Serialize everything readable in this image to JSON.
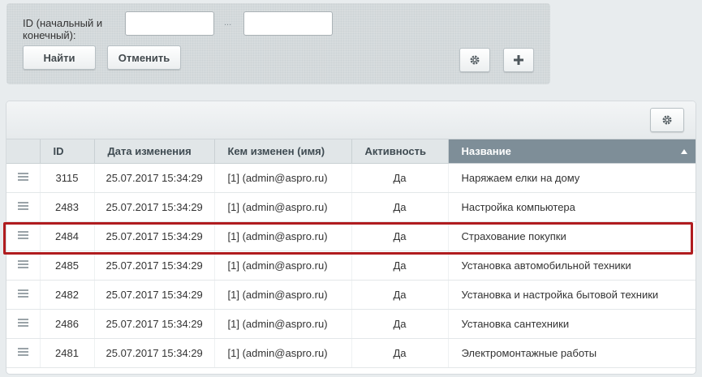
{
  "filter": {
    "id_label": "ID (начальный и конечный):",
    "id_from": "",
    "id_to": "",
    "range_separator": "...",
    "find_label": "Найти",
    "cancel_label": "Отменить",
    "settings_icon": "gear-icon",
    "add_icon": "plus-icon"
  },
  "list": {
    "settings_icon": "gear-icon",
    "columns": [
      "ID",
      "Дата изменения",
      "Кем изменен (имя)",
      "Активность",
      "Название"
    ],
    "sorted_column": "Название",
    "rows": [
      {
        "id": "3115",
        "date": "25.07.2017 15:34:29",
        "user": "[1] (admin@aspro.ru)",
        "active": "Да",
        "name": "Наряжаем елки на дому"
      },
      {
        "id": "2483",
        "date": "25.07.2017 15:34:29",
        "user": "[1] (admin@aspro.ru)",
        "active": "Да",
        "name": "Настройка компьютера"
      },
      {
        "id": "2484",
        "date": "25.07.2017 15:34:29",
        "user": "[1] (admin@aspro.ru)",
        "active": "Да",
        "name": "Страхование покупки"
      },
      {
        "id": "2485",
        "date": "25.07.2017 15:34:29",
        "user": "[1] (admin@aspro.ru)",
        "active": "Да",
        "name": "Установка автомобильной техники"
      },
      {
        "id": "2482",
        "date": "25.07.2017 15:34:29",
        "user": "[1] (admin@aspro.ru)",
        "active": "Да",
        "name": "Установка и настройка бытовой техники"
      },
      {
        "id": "2486",
        "date": "25.07.2017 15:34:29",
        "user": "[1] (admin@aspro.ru)",
        "active": "Да",
        "name": "Установка сантехники"
      },
      {
        "id": "2481",
        "date": "25.07.2017 15:34:29",
        "user": "[1] (admin@aspro.ru)",
        "active": "Да",
        "name": "Электромонтажные работы"
      }
    ]
  },
  "colors": {
    "highlight": "#b01c1f",
    "sorted_header": "#7e8e98"
  }
}
